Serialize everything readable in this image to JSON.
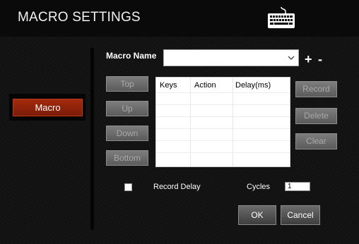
{
  "header": {
    "title": "MACRO SETTINGS",
    "icon": "keyboard-icon"
  },
  "sidebar": {
    "tab_label": "Macro",
    "active_color": "#9b250a"
  },
  "macro_name": {
    "label": "Macro Name",
    "value": "",
    "add_symbol": "+",
    "remove_symbol": "-"
  },
  "order_buttons": {
    "top": "Top",
    "up": "Up",
    "down": "Down",
    "bottom": "Bottom"
  },
  "table": {
    "columns": [
      "Keys",
      "Action",
      "Delay(ms)"
    ],
    "rows": []
  },
  "action_buttons": {
    "record": "Record",
    "delete": "Delete",
    "clear": "Clear"
  },
  "options": {
    "record_delay_label": "Record Delay",
    "record_delay_checked": false,
    "cycles_label": "Cycles",
    "cycles_value": "1"
  },
  "footer": {
    "ok": "OK",
    "cancel": "Cancel"
  }
}
